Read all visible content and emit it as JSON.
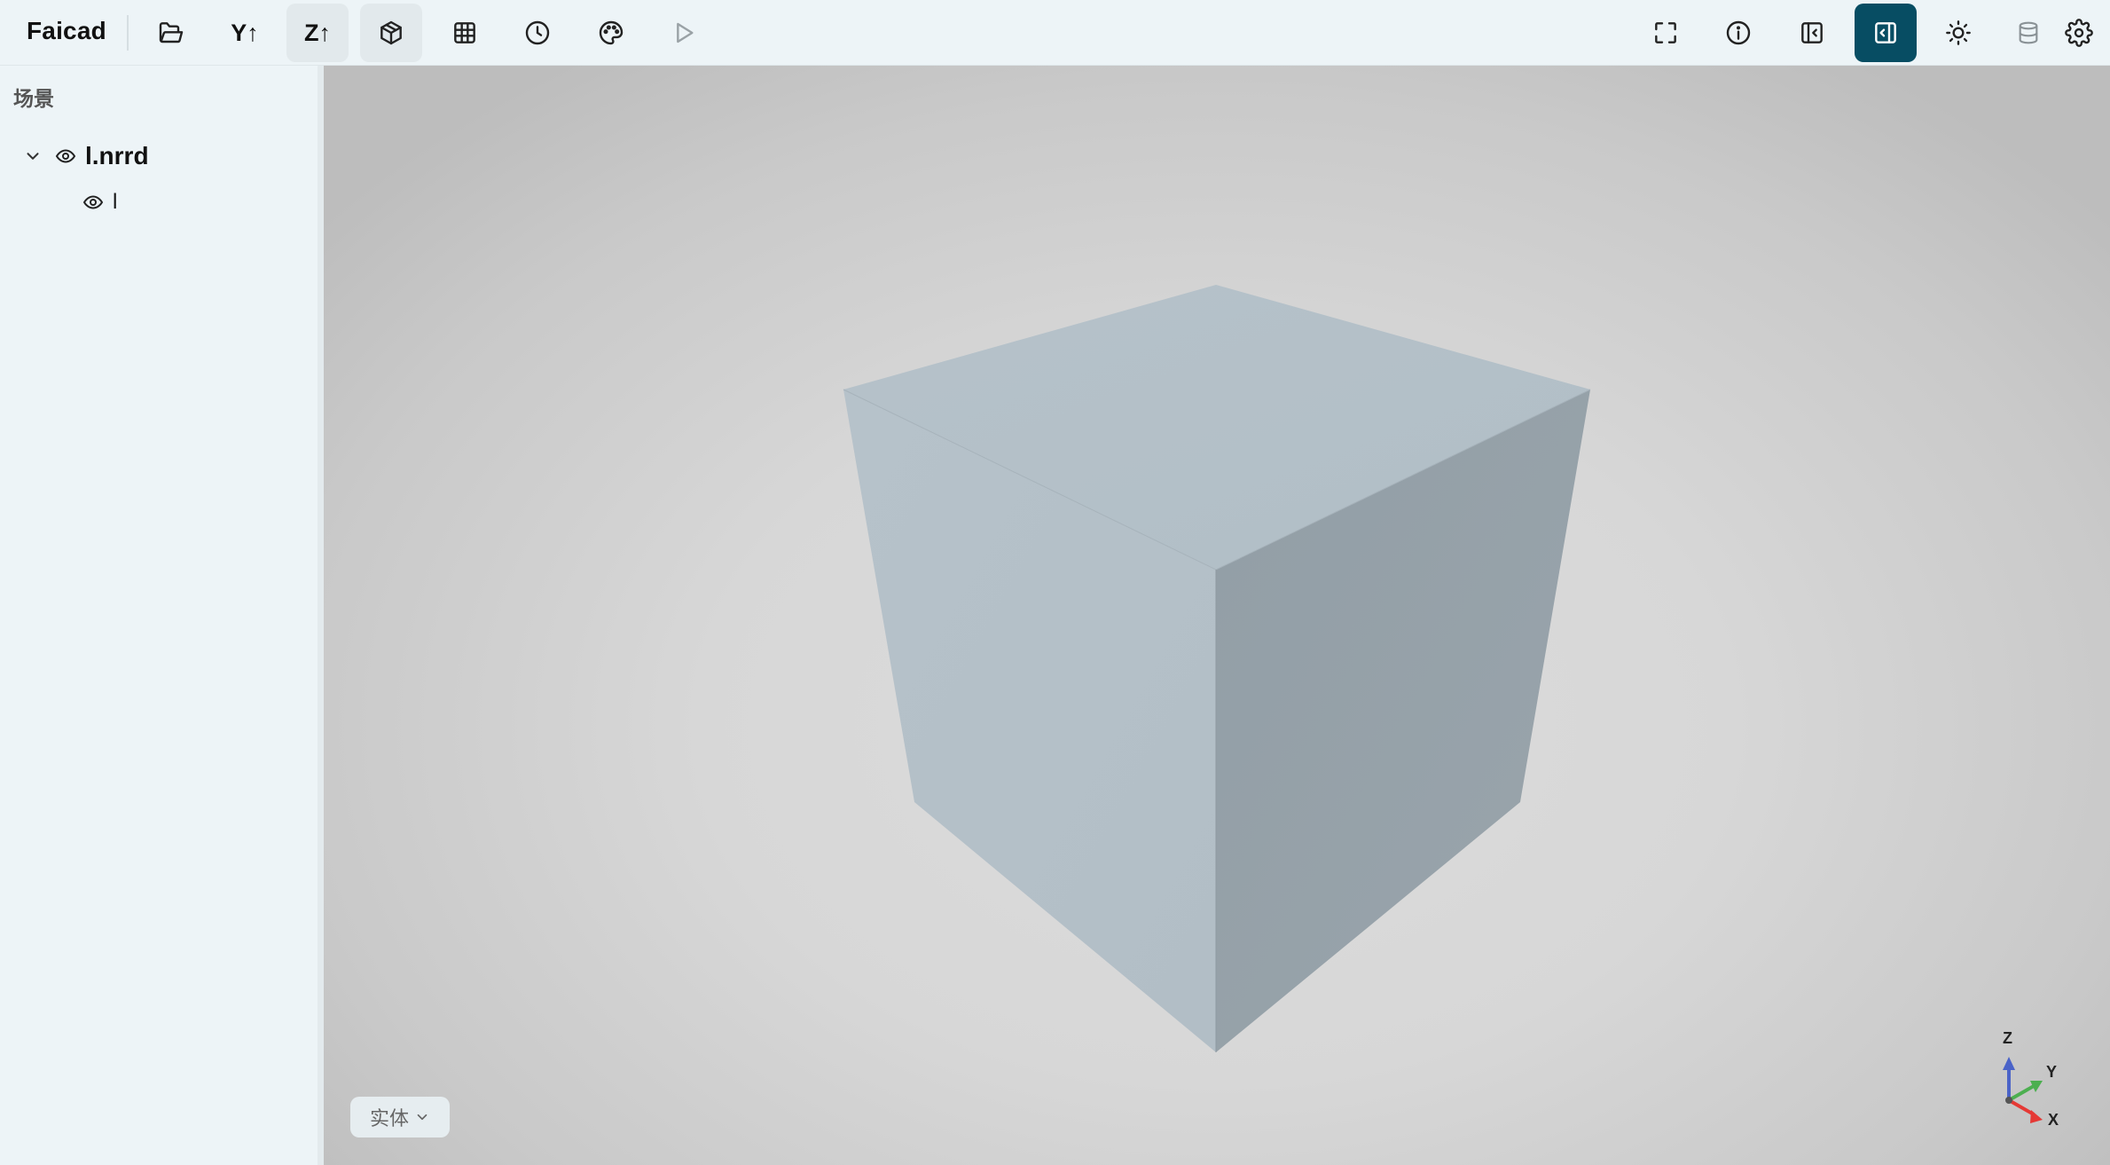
{
  "app": {
    "title": "Faicad"
  },
  "toolbar": {
    "left_buttons": [
      {
        "icon": "folder-open-icon",
        "name": "open-file-button"
      },
      {
        "icon": "y-up-icon",
        "label": "Y↑",
        "name": "y-up-button"
      },
      {
        "icon": "z-up-icon",
        "label": "Z↑",
        "name": "z-up-button",
        "active": true
      },
      {
        "icon": "cube-icon",
        "name": "solid-view-button",
        "active": true
      },
      {
        "icon": "grid-icon",
        "name": "grid-toggle-button"
      },
      {
        "icon": "clock-icon",
        "name": "history-button"
      },
      {
        "icon": "palette-icon",
        "name": "material-button"
      },
      {
        "icon": "play-icon",
        "name": "run-button"
      }
    ],
    "right_buttons": [
      {
        "icon": "fullscreen-icon",
        "name": "fullscreen-button"
      },
      {
        "icon": "info-icon",
        "name": "info-button"
      },
      {
        "icon": "left-panel-icon",
        "name": "toggle-left-panel-button"
      },
      {
        "icon": "right-panel-icon",
        "name": "toggle-right-panel-button",
        "active": true
      },
      {
        "icon": "sun-icon",
        "name": "theme-button"
      },
      {
        "icon": "database-icon",
        "name": "database-button"
      },
      {
        "icon": "gear-icon",
        "name": "settings-button"
      }
    ],
    "accent_color": "#074d63"
  },
  "sidebar": {
    "heading": "场景",
    "tree": {
      "root": {
        "label": "l.nrrd",
        "expanded": true,
        "visible": true
      },
      "children": [
        {
          "label": "l",
          "visible": true
        }
      ]
    }
  },
  "viewport": {
    "object_color": "#b3c0c8",
    "display_mode": "实体",
    "axes": {
      "z_label": "Z",
      "y_label": "Y",
      "x_label": "X",
      "z_color": "#4a63c8",
      "y_color": "#4caf50",
      "x_color": "#e53935"
    }
  }
}
